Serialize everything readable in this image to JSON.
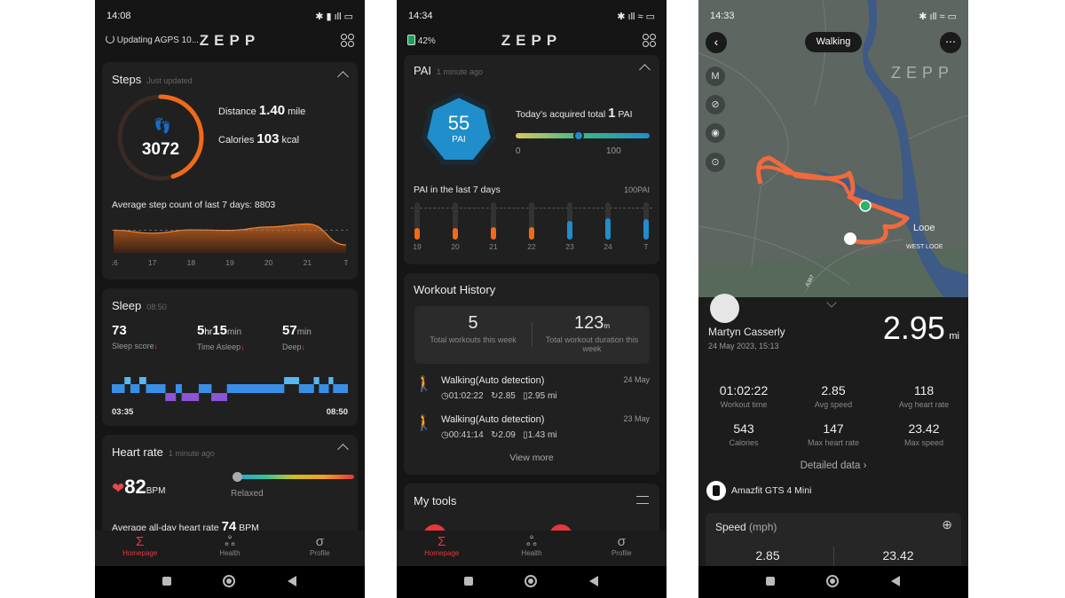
{
  "colors": {
    "accent": "#e5383b",
    "steps_orange": "#f06a1a",
    "pai_blue": "#1f8ecb",
    "sleep_light": "#3a8ee6",
    "sleep_rem": "#55b8f0",
    "sleep_deep": "#8a55d6",
    "route": "#f06a3d"
  },
  "nav": {
    "items": [
      {
        "label": "Homepage",
        "icon": "sigma-icon"
      },
      {
        "label": "Health",
        "icon": "health-icon"
      },
      {
        "label": "Profile",
        "icon": "profile-icon"
      }
    ]
  },
  "logo": "ZEPP",
  "screen1": {
    "time": "14:08",
    "header_status": "Updating AGPS 10...",
    "steps": {
      "title": "Steps",
      "updated": "Just updated",
      "count": "3072",
      "goal_fraction": 0.45,
      "distance_label": "Distance",
      "distance": "1.40",
      "distance_unit": "mile",
      "calories_label": "Calories",
      "calories": "103",
      "calories_unit": "kcal",
      "average_text": "Average step count of last 7 days: 8803",
      "chart": {
        "days": [
          "16",
          "17",
          "18",
          "19",
          "20",
          "21",
          "T"
        ],
        "values": [
          8800,
          7600,
          8900,
          8700,
          10000,
          11200,
          3072
        ],
        "average": 8803
      }
    },
    "sleep": {
      "title": "Sleep",
      "time": "08:50",
      "score": "73",
      "score_label": "Sleep score",
      "hr": "5",
      "hr_unit": "hr",
      "min": "15",
      "min_unit": "min",
      "asleep_label": "Time Asleep",
      "deep": "57",
      "deep_unit": "min",
      "deep_label": "Deep",
      "start": "03:35",
      "end": "08:50",
      "stages": [
        [
          "light",
          17
        ],
        [
          "rem",
          8
        ],
        [
          "light",
          12
        ],
        [
          "rem",
          9
        ],
        [
          "light",
          26
        ],
        [
          "deep",
          14
        ],
        [
          "light",
          8
        ],
        [
          "deep",
          23
        ],
        [
          "light",
          17
        ],
        [
          "deep",
          21
        ],
        [
          "light",
          77
        ],
        [
          "rem",
          20
        ],
        [
          "light",
          20
        ],
        [
          "rem",
          7
        ],
        [
          "light",
          13
        ],
        [
          "rem",
          6
        ],
        [
          "light",
          20
        ]
      ]
    },
    "heart": {
      "title": "Heart rate",
      "updated": "1 minute ago",
      "bpm": "82",
      "unit": "BPM",
      "zone": "Relaxed",
      "avg_label": "Average all-day heart rate",
      "avg": "74",
      "avg_unit": "BPM"
    }
  },
  "screen2": {
    "time": "14:34",
    "watch_battery": "42%",
    "pai": {
      "title": "PAI",
      "updated": "1 minute ago",
      "score": "55",
      "unit": "PAI",
      "today_label": "Today's acquired total",
      "today": "1",
      "today_unit": "PAI",
      "scale_min": "0",
      "scale_max": "100",
      "slider_value": 47,
      "week_label": "PAI in the last 7 days",
      "week_max": "100PAI",
      "days": [
        "19",
        "20",
        "21",
        "22",
        "23",
        "24",
        "T"
      ],
      "values": [
        30,
        32,
        33,
        33,
        50,
        57,
        55
      ]
    },
    "workouts": {
      "title": "Workout History",
      "total": "5",
      "total_label": "Total workouts this week",
      "duration": "123",
      "duration_unit": "m",
      "duration_label": "Total workout duration this week",
      "items": [
        {
          "name": "Walking(Auto detection)",
          "date": "24 May",
          "time": "01:02:22",
          "pace": "2.85",
          "distance": "2.95 mi"
        },
        {
          "name": "Walking(Auto detection)",
          "date": "23 May",
          "time": "00:41:14",
          "pace": "2.09",
          "distance": "1.43 mi"
        }
      ],
      "view_more": "View more"
    },
    "tools": {
      "title": "My tools"
    }
  },
  "screen3": {
    "time": "14:33",
    "activity": "Walking",
    "map_labels": {
      "town": "Looe",
      "area": "WEST LOOE",
      "road": "A387"
    },
    "user": "Martyn Casserly",
    "date": "24 May 2023, 15:13",
    "distance": "2.95",
    "distance_unit": "mi",
    "stats": [
      {
        "v": "01:02:22",
        "l": "Workout time"
      },
      {
        "v": "2.85",
        "l": "Avg speed"
      },
      {
        "v": "118",
        "l": "Avg heart rate"
      },
      {
        "v": "543",
        "l": "Calories"
      },
      {
        "v": "147",
        "l": "Max heart rate"
      },
      {
        "v": "23.42",
        "l": "Max speed"
      }
    ],
    "detailed": "Detailed data",
    "device": "Amazfit GTS 4 Mini",
    "speed_title": "Speed",
    "speed_unit": "(mph)",
    "speed_avg": "2.85",
    "speed_max": "23.42"
  }
}
